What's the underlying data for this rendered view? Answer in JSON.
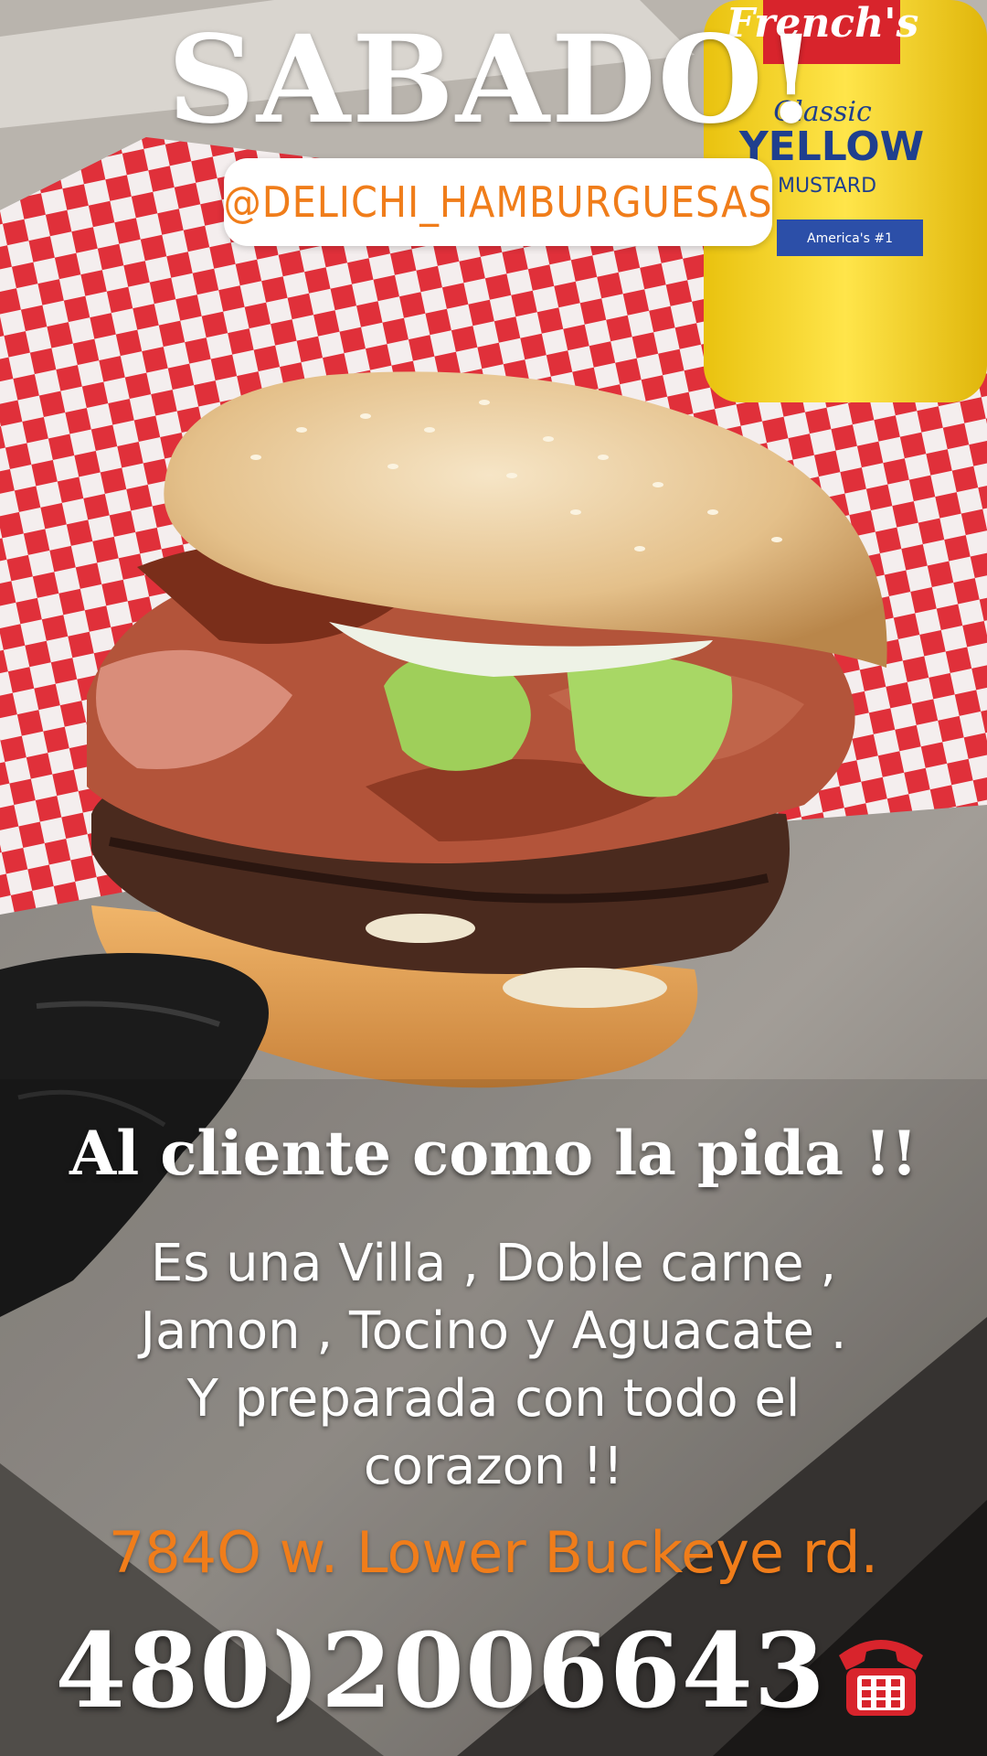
{
  "story": {
    "title": "SABADO!",
    "handle": "@DELICHI_HAMBURGUESAS",
    "tagline": "Al cliente como la pida !!",
    "description_lines": [
      "Es una Villa , Doble carne ,",
      "Jamon , Tocino y Aguacate .",
      "Y preparada con todo el",
      "corazon !!"
    ],
    "address": "784O  w. Lower Buckeye rd.",
    "phone": "480)2006643",
    "phone_icon": "telephone-icon"
  },
  "background": {
    "mustard_label": {
      "brand": "French's",
      "line1": "Classic",
      "line2": "YELLOW",
      "line3": "MUSTARD",
      "line4": "America's #1"
    }
  },
  "colors": {
    "accent_orange": "#f07d1a",
    "text_white": "#ffffff",
    "checker_red": "#e0303a"
  }
}
